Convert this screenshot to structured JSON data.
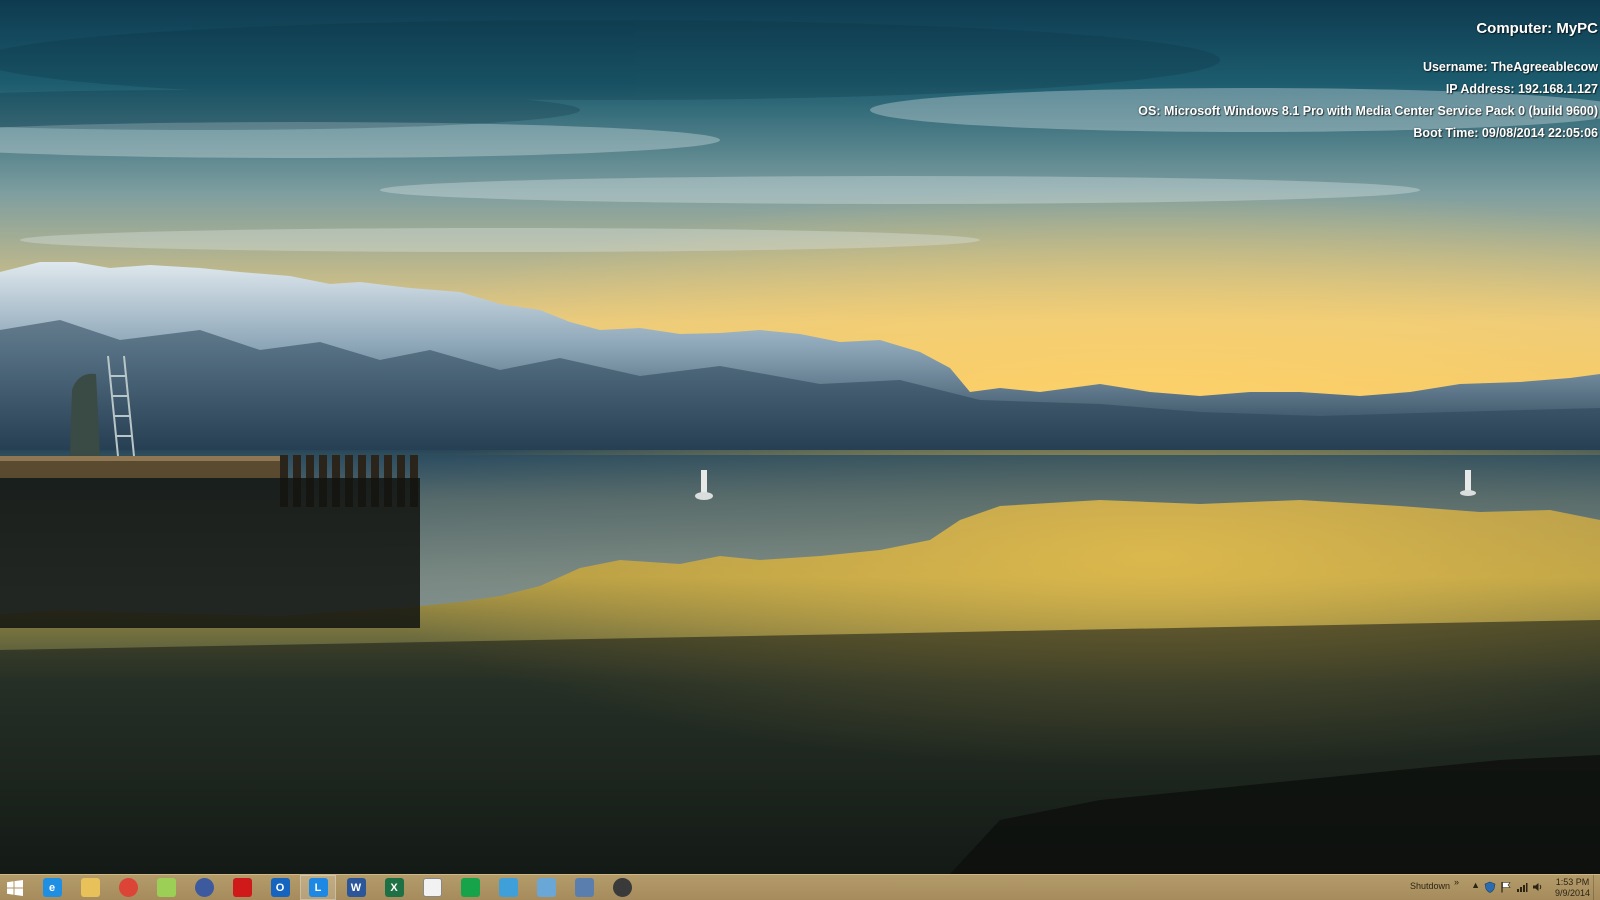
{
  "desktop": {
    "wallpaper": {
      "colors": {
        "sky_top": "#103d52",
        "sky_horizon": "#f6c45a",
        "mountain_snow": "#c9d6df",
        "mountain_shadow": "#1d3345",
        "water": "#1e2a24"
      }
    },
    "sysinfo": {
      "computer": "Computer: MyPC",
      "username": "Username: TheAgreeablecow",
      "ip_address": "IP Address: 192.168.1.127",
      "os": "OS: Microsoft Windows 8.1 Pro with Media Center Service Pack 0 (build 9600)",
      "boot_time": "Boot Time: 09/08/2014 22:05:06"
    }
  },
  "taskbar": {
    "background": "#ae9563",
    "start_icon": "windows-logo-icon",
    "buttons": [
      {
        "icon": "internet-explorer-icon",
        "color": "#1f8fe3",
        "glyph": "e",
        "active": false
      },
      {
        "icon": "file-explorer-icon",
        "color": "#e8c15a",
        "glyph": "",
        "active": false
      },
      {
        "icon": "chrome-icon",
        "color": "#db4437",
        "glyph": "",
        "active": false
      },
      {
        "icon": "notepad-icon",
        "color": "#9ccf55",
        "glyph": "",
        "active": false
      },
      {
        "icon": "circle-app-icon",
        "color": "#3d5a9e",
        "glyph": "",
        "active": false
      },
      {
        "icon": "red-splat-app-icon",
        "color": "#d01919",
        "glyph": "",
        "active": false
      },
      {
        "icon": "outlook-icon",
        "color": "#1565c0",
        "glyph": "O",
        "active": false
      },
      {
        "icon": "lync-icon",
        "color": "#1e88e5",
        "glyph": "L",
        "active": true
      },
      {
        "icon": "word-icon",
        "color": "#2b579a",
        "glyph": "W",
        "active": false
      },
      {
        "icon": "excel-icon",
        "color": "#1e7145",
        "glyph": "X",
        "active": false
      },
      {
        "icon": "grid-app-icon",
        "color": "#f2f2f2",
        "glyph": "",
        "active": false
      },
      {
        "icon": "store-icon",
        "color": "#17a34a",
        "glyph": "",
        "active": false
      },
      {
        "icon": "remote-desktop-icon",
        "color": "#3fa0d9",
        "glyph": "",
        "active": false
      },
      {
        "icon": "network-app-icon",
        "color": "#6aa7d6",
        "glyph": "",
        "active": false
      },
      {
        "icon": "calculator-icon",
        "color": "#5a7fae",
        "glyph": "",
        "active": false
      },
      {
        "icon": "dark-circle-app-icon",
        "color": "#3a3a3a",
        "glyph": "",
        "active": false
      }
    ],
    "tray": {
      "shutdown_label": "Shutdown",
      "chevron": "»",
      "up_arrow": "▲",
      "icons": [
        "shield-tray-icon",
        "flag-tray-icon",
        "network-tray-icon",
        "volume-tray-icon"
      ],
      "time": "1:53 PM",
      "date": "9/9/2014"
    }
  }
}
